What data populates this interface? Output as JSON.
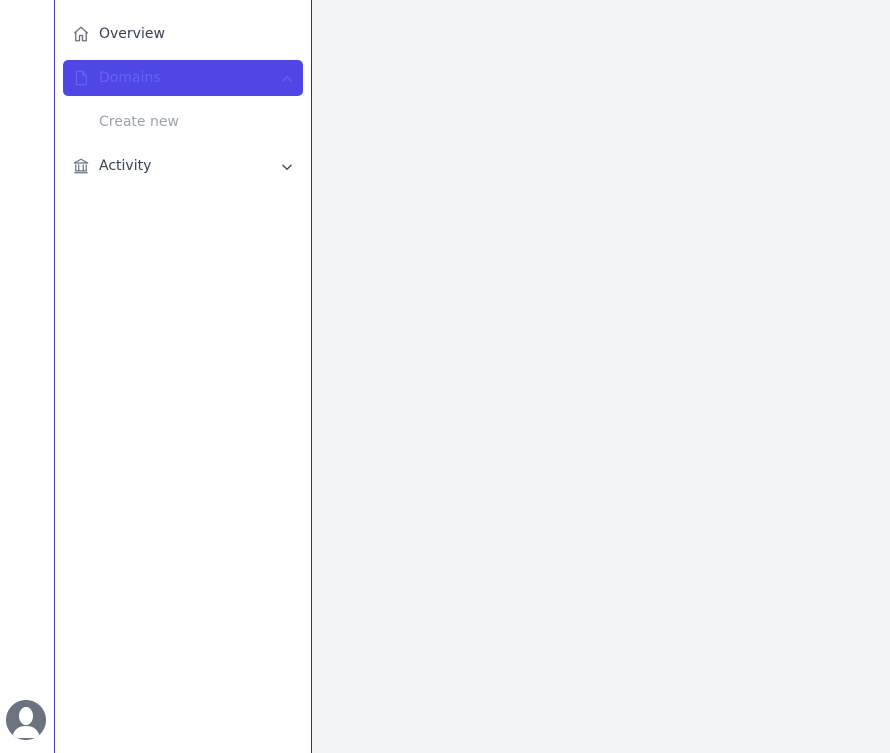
{
  "sidebar": {
    "items": [
      {
        "label": "Overview",
        "icon": "home-icon"
      },
      {
        "label": "Domains",
        "icon": "document-icon",
        "expanded": true,
        "active": true
      },
      {
        "label": "Create new",
        "icon": "",
        "sub": true
      },
      {
        "label": "Activity",
        "icon": "bank-icon",
        "expanded": false
      }
    ]
  },
  "colors": {
    "accent": "#4f46e5",
    "accent_text": "#6366f1",
    "main_bg": "#f3f4f6",
    "text": "#374151",
    "muted": "#9ca3af"
  }
}
